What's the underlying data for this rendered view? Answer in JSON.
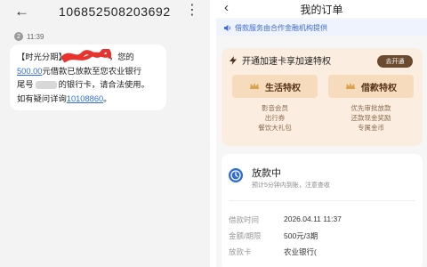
{
  "sms": {
    "number": "10685250820369​2",
    "time": "11:39",
    "sim": "2",
    "line1_prefix": "【时光分期】",
    "line1_suffix": "，您的",
    "amount_link": "500.00",
    "line2_rest": "元借款已放款至您农业银行",
    "line3_prefix": "尾号",
    "line3_rest": "的银行卡，请合法使用。",
    "line4_prefix": "如有疑问详询",
    "phone_link": "10108860",
    "line4_suffix": "。"
  },
  "orders": {
    "title": "我的订单",
    "notice": "借款服务由合作金融机构提供",
    "vip": {
      "title": "开通加速卡享加速特权",
      "button": "去开通",
      "left_tab": "生活特权",
      "right_tab": "借款特权",
      "left_items": [
        "影音会员",
        "出行券",
        "餐饮大礼包"
      ],
      "right_items": [
        "优先审批放款",
        "还款现金奖励",
        "专属金币"
      ]
    },
    "status": {
      "title": "放款中",
      "subtitle": "预计5分钟内到账，注意查收"
    },
    "details": [
      {
        "label": "借款时间",
        "value": "2026.04.11 11:37"
      },
      {
        "label": "金额/期限",
        "value": "500元/3期"
      },
      {
        "label": "放款卡",
        "value": "农业银行("
      }
    ]
  },
  "colors": {
    "link": "#2d6fd8",
    "notice_bg": "#eef3fd",
    "vip_bg": "#fbeee0",
    "vip_button": "#6a4b30",
    "status_icon": "#2f6bd9"
  }
}
